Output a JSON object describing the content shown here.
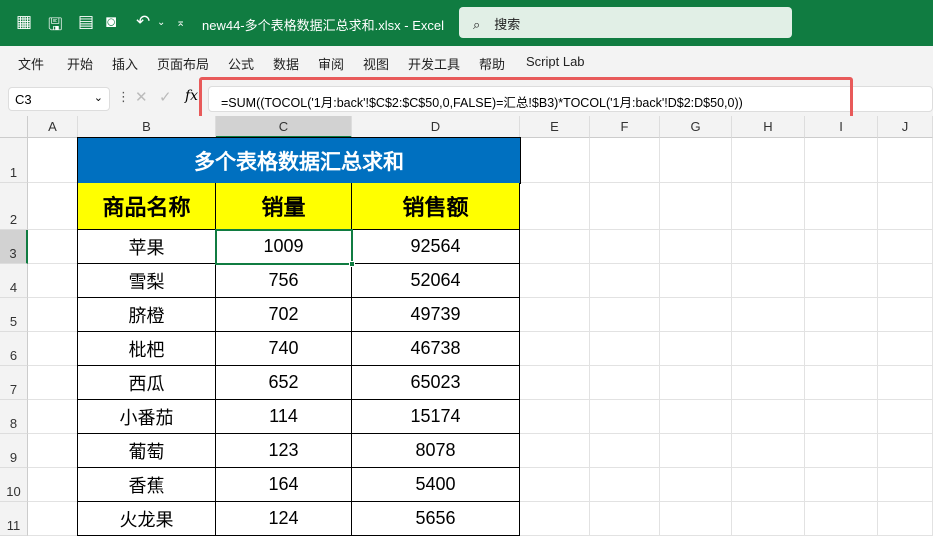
{
  "window": {
    "title": "new44-多个表格数据汇总求和.xlsx  -  Excel",
    "search_placeholder": "搜索"
  },
  "menu": [
    "文件",
    "开始",
    "插入",
    "页面布局",
    "公式",
    "数据",
    "审阅",
    "视图",
    "开发工具",
    "帮助",
    "Script Lab"
  ],
  "formula_bar": {
    "name_box": "C3",
    "formula": "=SUM((TOCOL('1月:back'!$C$2:$C$50,0,FALSE)=汇总!$B3)*TOCOL('1月:back'!D$2:D$50,0))"
  },
  "columns": [
    "A",
    "B",
    "C",
    "D",
    "E",
    "F",
    "G",
    "H",
    "I",
    "J"
  ],
  "rows": [
    "1",
    "2",
    "3",
    "4",
    "5",
    "6",
    "7",
    "8",
    "9",
    "10",
    "11"
  ],
  "table": {
    "title": "多个表格数据汇总求和",
    "headers": [
      "商品名称",
      "销量",
      "销售额"
    ],
    "rows": [
      [
        "苹果",
        "1009",
        "92564"
      ],
      [
        "雪梨",
        "756",
        "52064"
      ],
      [
        "脐橙",
        "702",
        "49739"
      ],
      [
        "枇杷",
        "740",
        "46738"
      ],
      [
        "西瓜",
        "652",
        "65023"
      ],
      [
        "小番茄",
        "114",
        "15174"
      ],
      [
        "葡萄",
        "123",
        "8078"
      ],
      [
        "香蕉",
        "164",
        "5400"
      ],
      [
        "火龙果",
        "124",
        "5656"
      ]
    ]
  },
  "colors": {
    "title_bg": "#0070c0",
    "header_bg": "#ffff00",
    "excel_green": "#107c41",
    "highlight": "#e85a5a"
  }
}
